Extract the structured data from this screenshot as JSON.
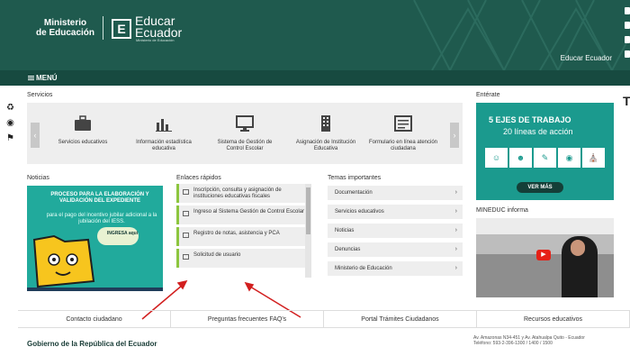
{
  "header": {
    "ministry_line1": "Ministerio",
    "ministry_line2": "de Educación",
    "brand_letter": "E",
    "brand_line1": "Educar",
    "brand_line2": "Ecuador",
    "brand_tagline": "Ministerio de Educación",
    "right_link": "Educar Ecuador",
    "color": "#1f5a4e"
  },
  "menu": {
    "label": "MENÚ"
  },
  "sections": {
    "servicios": "Servicios",
    "enterate": "Entérate",
    "noticias": "Noticias",
    "enlaces": "Enlaces rápidos",
    "temas": "Temas importantes",
    "mineduc": "MINEDUC informa"
  },
  "services": [
    {
      "label": "Servicios educativos",
      "icon": "briefcase-icon"
    },
    {
      "label": "Información estadística educativa",
      "icon": "bar-chart-icon"
    },
    {
      "label": "Sistema de Gestión de Control Escolar",
      "icon": "monitor-icon"
    },
    {
      "label": "Asignación de Institución Educativa",
      "icon": "building-icon"
    },
    {
      "label": "Formulario en línea atención ciudadana",
      "icon": "form-icon"
    }
  ],
  "enterate_banner": {
    "line1": "5 EJES DE TRABAJO",
    "line2": "20 líneas de acción",
    "button": "VER MÁS"
  },
  "noticias_banner": {
    "title": "PROCESO PARA LA ELABORACIÓN Y VALIDACIÓN DEL EXPEDIENTE",
    "subtitle": "para el pago del incentivo jubilar adicional a la jubilación del IESS.",
    "cta": "INGRESA aquí"
  },
  "enlaces": [
    {
      "label": "Inscripción, consulta y asignación de instituciones educativas fiscales",
      "icon": "document-icon"
    },
    {
      "label": "Ingreso al Sistema Gestión de Control Escolar",
      "icon": "laptop-icon"
    },
    {
      "label": "Registro de notas, asistencia y PCA",
      "icon": "save-icon"
    },
    {
      "label": "Solicitud de usuario",
      "icon": "add-user-icon"
    }
  ],
  "temas": [
    {
      "label": "Documentación"
    },
    {
      "label": "Servicios educativos"
    },
    {
      "label": "Noticias"
    },
    {
      "label": "Denuncias"
    },
    {
      "label": "Ministerio de Educación"
    }
  ],
  "bottom_links": [
    {
      "label": "Contacto ciudadano"
    },
    {
      "label": "Preguntas frecuentes FAQ's"
    },
    {
      "label": "Portal Trámites Ciudadanos"
    },
    {
      "label": "Recursos educativos"
    }
  ],
  "footer": {
    "left": "Gobierno de la República del Ecuador",
    "right_line1": "Av. Amazonas N34-451 y Av. Atahualpa Quito - Ecuador",
    "right_line2": "Teléfono: 593-2-396-1300 / 1400 / 1500"
  }
}
